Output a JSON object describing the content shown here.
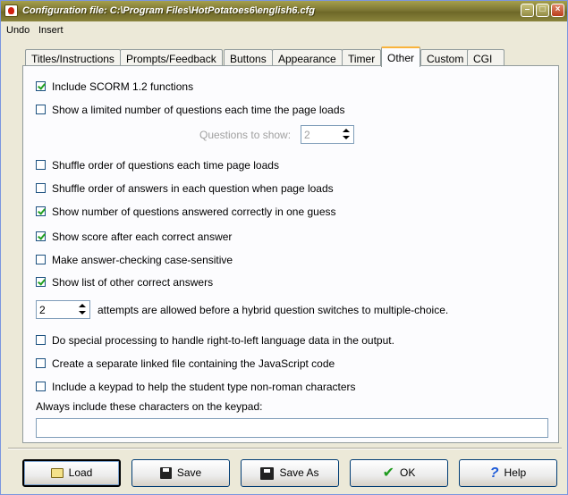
{
  "window": {
    "title": "Configuration file: C:\\Program Files\\HotPotatoes6\\english6.cfg"
  },
  "menu": [
    "Undo",
    "Insert"
  ],
  "tabs": [
    "Titles/Instructions",
    "Prompts/Feedback",
    "Buttons",
    "Appearance",
    "Timer",
    "Other",
    "Custom",
    "CGI"
  ],
  "active_tab": "Other",
  "options": {
    "scorm": {
      "label": "Include SCORM 1.2 functions",
      "checked": true
    },
    "limit_questions": {
      "label": "Show a limited number of questions each time the page loads",
      "checked": false
    },
    "questions_to_show": {
      "label": "Questions to show:",
      "value": "2"
    },
    "shuffle_questions": {
      "label": "Shuffle order of questions each time page loads",
      "checked": false
    },
    "shuffle_answers": {
      "label": "Shuffle order of answers in each question when page loads",
      "checked": false
    },
    "show_correct_first": {
      "label": "Show number of questions answered correctly in one guess",
      "checked": true
    },
    "show_score": {
      "label": "Show score after each correct answer",
      "checked": true
    },
    "case_sensitive": {
      "label": "Make answer-checking case-sensitive",
      "checked": false
    },
    "show_other_answers": {
      "label": "Show list of other correct answers",
      "checked": true
    },
    "attempts": {
      "value": "2",
      "label": "attempts are allowed before a hybrid question switches to multiple-choice."
    },
    "rtl": {
      "label": "Do special processing to handle right-to-left language data in the output.",
      "checked": false
    },
    "separate_js": {
      "label": "Create a separate linked file containing the JavaScript code",
      "checked": false
    },
    "keypad": {
      "label": "Include a keypad to help the student type non-roman characters",
      "checked": false
    },
    "keypad_chars": {
      "label": "Always include these characters on the keypad:",
      "value": ""
    }
  },
  "buttons": {
    "load": "Load",
    "save": "Save",
    "save_as": "Save As",
    "ok": "OK",
    "help": "Help"
  }
}
